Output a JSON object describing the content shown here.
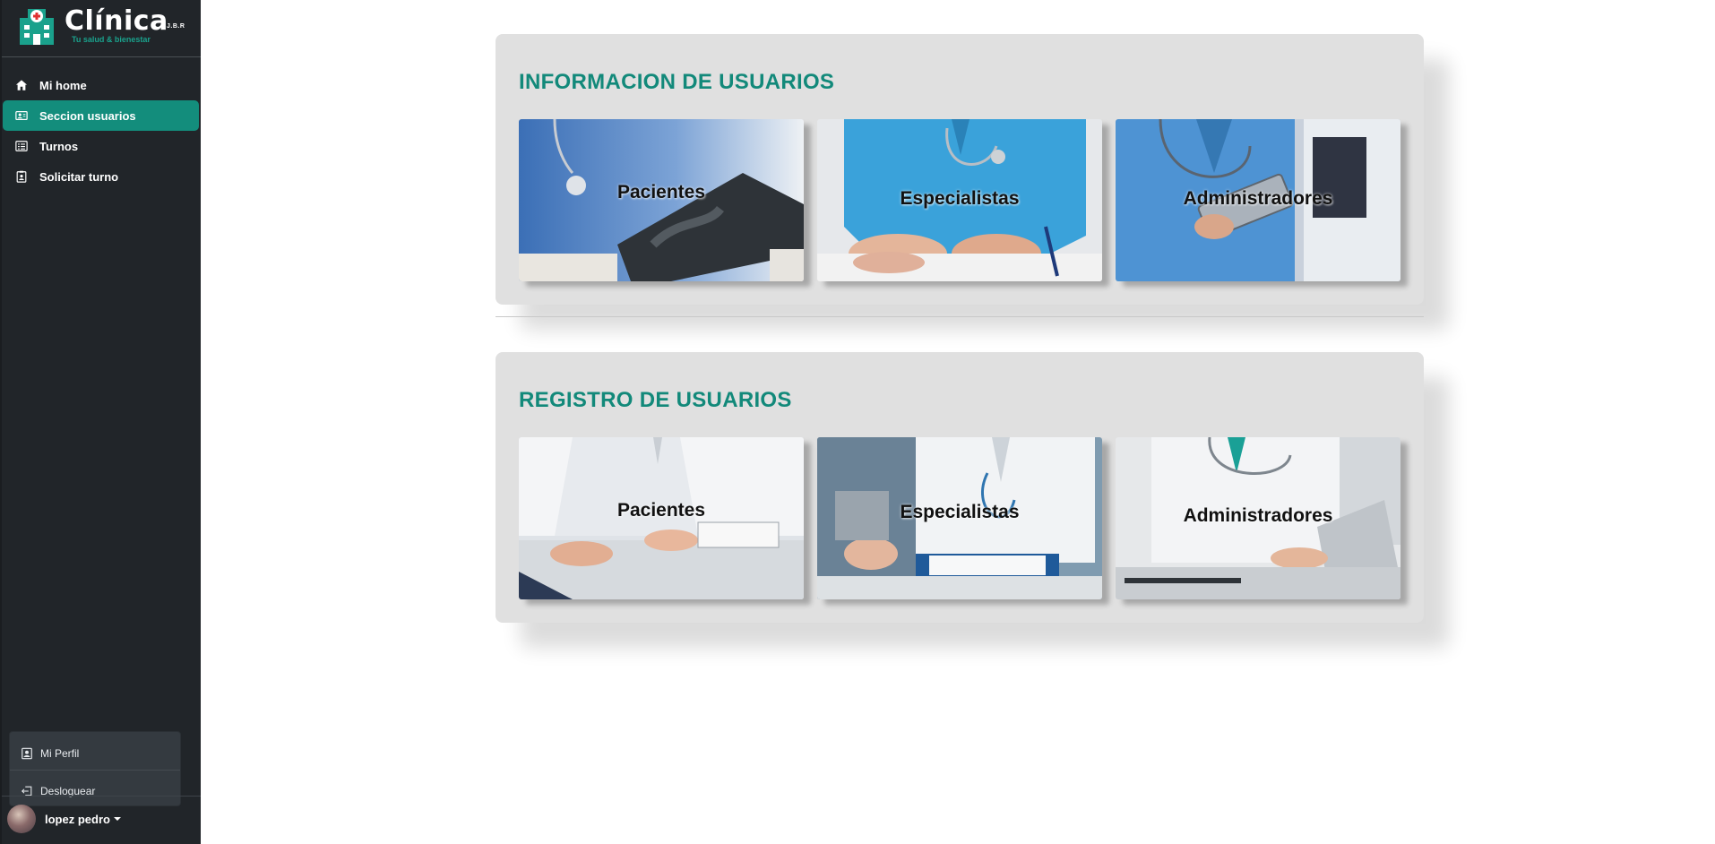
{
  "brand": {
    "name": "Clínica",
    "suffix": "J.B.R",
    "tagline": "Tu salud & bienestar"
  },
  "sidebar": {
    "items": [
      {
        "label": "Mi home",
        "icon": "home-icon",
        "active": false
      },
      {
        "label": "Seccion usuarios",
        "icon": "user-card-icon",
        "active": true
      },
      {
        "label": "Turnos",
        "icon": "list-icon",
        "active": false
      },
      {
        "label": "Solicitar turno",
        "icon": "clipboard-person-icon",
        "active": false
      }
    ]
  },
  "user_menu": {
    "items": [
      {
        "label": "Mi Perfil",
        "icon": "profile-icon"
      },
      {
        "label": "Desloguear",
        "icon": "logout-icon"
      }
    ],
    "user_name": "lopez pedro"
  },
  "sections": [
    {
      "title": "INFORMACION DE USUARIOS",
      "tiles": [
        {
          "label": "Pacientes"
        },
        {
          "label": "Especialistas"
        },
        {
          "label": "Administradores"
        }
      ]
    },
    {
      "title": "REGISTRO DE USUARIOS",
      "tiles": [
        {
          "label": "Pacientes"
        },
        {
          "label": "Especialistas"
        },
        {
          "label": "Administradores"
        }
      ]
    }
  ],
  "colors": {
    "sidebar_bg": "#212529",
    "accent": "#138d7c",
    "section_title": "#12897a",
    "card_bg": "#e0e0e0"
  }
}
